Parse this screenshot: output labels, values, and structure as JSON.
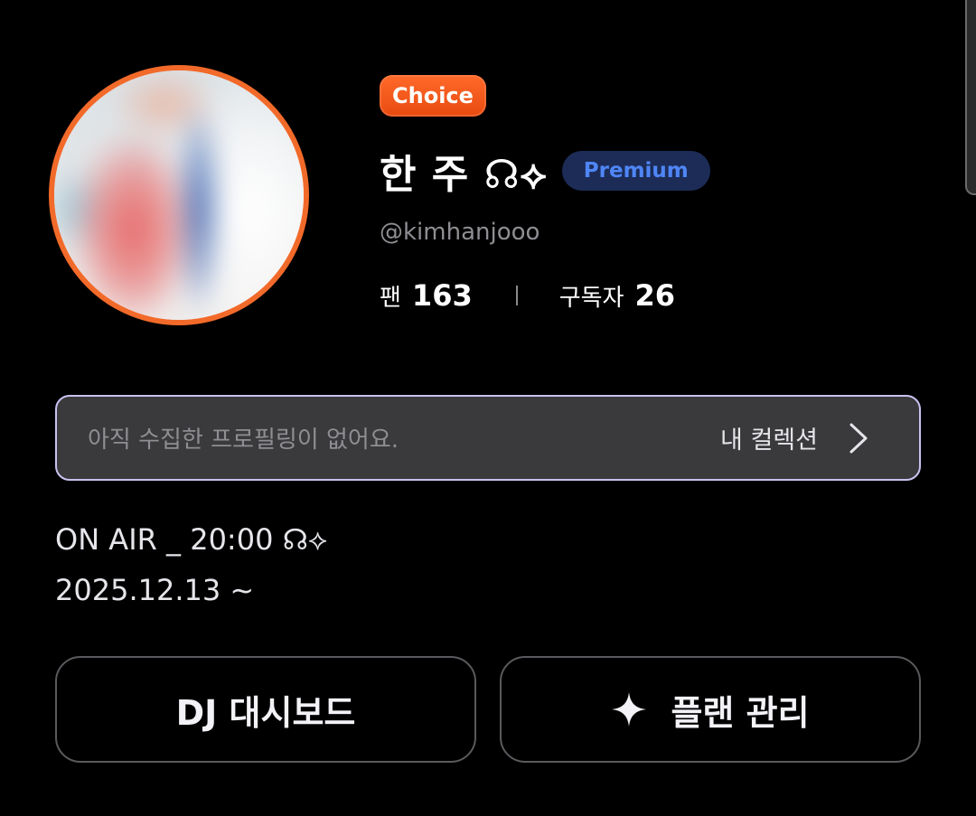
{
  "profile": {
    "badge": "Choice",
    "name": "한 주 ☊⟡",
    "name_icon": "headphones-sparkle-emoji",
    "tier": "Premium",
    "handle": "@kimhanjooo",
    "avatar_image": "blurred-profile-photo"
  },
  "stats": {
    "fans_label": "팬",
    "fans_value": "163",
    "subscribers_label": "구독자",
    "subscribers_value": "26"
  },
  "collection": {
    "empty_text": "아직 수집한 프로필링이 없어요.",
    "link_label": "내 컬렉션",
    "chevron_icon": "chevron-right-icon"
  },
  "bio": {
    "line1": "ON AIR _ 20:00 ☊⟡",
    "line2": "2025.12.13 ~"
  },
  "actions": {
    "dashboard_label": "DJ 대시보드",
    "plan_label": "플랜 관리",
    "plan_icon": "sparkle-icon"
  },
  "colors": {
    "background": "#000000",
    "avatar_ring": "#f26a2a",
    "choice_badge": "#ff5a1f",
    "premium_badge_bg": "#1c2c57",
    "premium_badge_text": "#4f86f7",
    "collection_border": "#c9c1f0",
    "collection_bg": "#3a3a3c"
  }
}
